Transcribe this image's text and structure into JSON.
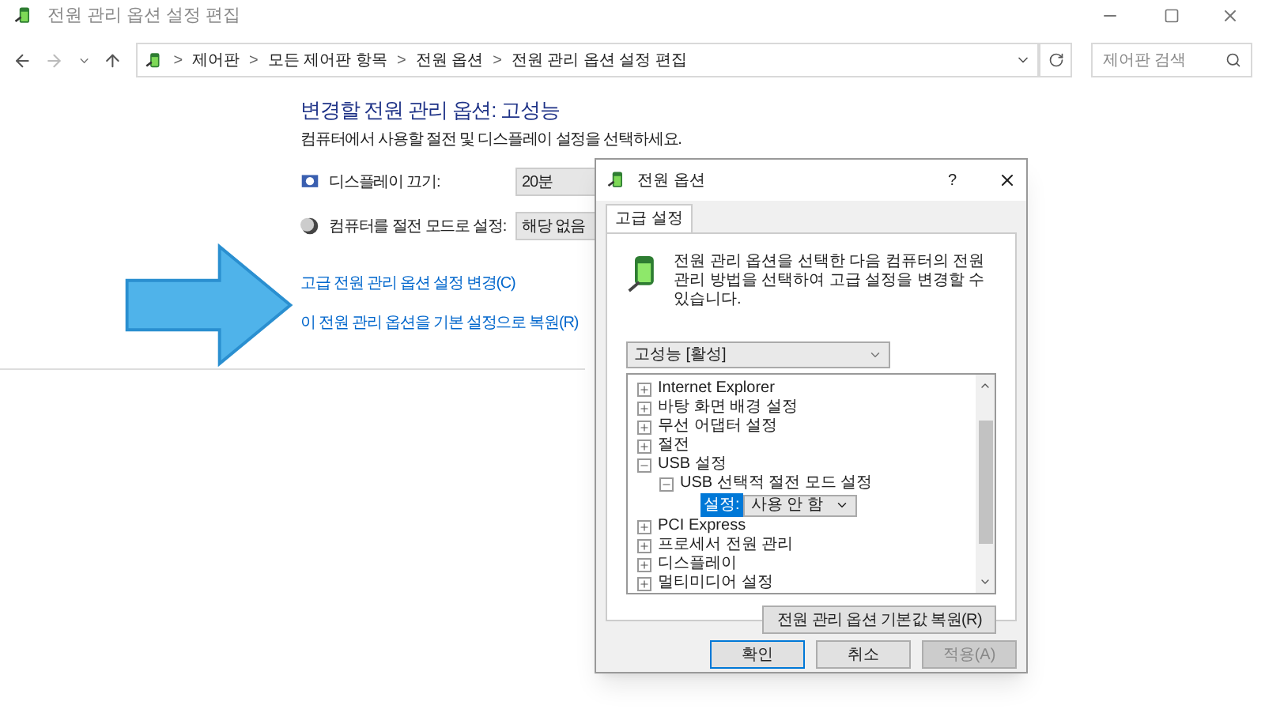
{
  "window": {
    "title": "전원 관리 옵션 설정 편집"
  },
  "address": {
    "crumbs": [
      "제어판",
      "모든 제어판 항목",
      "전원 옵션",
      "전원 관리 옵션 설정 편집"
    ],
    "separator": ">"
  },
  "search": {
    "placeholder": "제어판 검색"
  },
  "content": {
    "heading": "변경할 전원 관리 옵션: 고성능",
    "description": "컴퓨터에서 사용할 절전 및 디스플레이 설정을 선택하세요.",
    "settings": [
      {
        "label": "디스플레이 끄기:",
        "value": "20분",
        "kind": "display"
      },
      {
        "label": "컴퓨터를 절전 모드로 설정:",
        "value": "해당 없음",
        "kind": "sleep"
      }
    ],
    "links": [
      "고급 전원 관리 옵션 설정 변경(C)",
      "이 전원 관리 옵션을 기본 설정으로 복원(R)"
    ]
  },
  "dialog": {
    "title": "전원 옵션",
    "help": "?",
    "tabs": [
      {
        "label": "고급 설정",
        "selected": true
      }
    ],
    "intro": "전원 관리 옵션을 선택한 다음 컴퓨터의 전원 관리 방법을 선택하여 고급 설정을 변경할 수 있습니다.",
    "plan": "고성능 [활성]",
    "tree": [
      {
        "label": "Internet Explorer",
        "expanded": false
      },
      {
        "label": "바탕 화면 배경 설정",
        "expanded": false
      },
      {
        "label": "무선 어댑터 설정",
        "expanded": false
      },
      {
        "label": "절전",
        "expanded": false
      },
      {
        "label": "USB 설정",
        "expanded": true,
        "children": [
          {
            "label": "USB 선택적 절전 모드 설정",
            "expanded": true,
            "setting": {
              "label": "설정:",
              "value": "사용 안 함",
              "selected": true
            }
          }
        ]
      },
      {
        "label": "PCI Express",
        "expanded": false
      },
      {
        "label": "프로세서 전원 관리",
        "expanded": false
      },
      {
        "label": "디스플레이",
        "expanded": false
      },
      {
        "label": "멀티미디어 설정",
        "expanded": false
      }
    ],
    "restore": "전원 관리 옵션 기본값 복원(R)",
    "buttons": [
      {
        "label": "확인",
        "disabled": false,
        "default": true
      },
      {
        "label": "취소",
        "disabled": false,
        "default": false
      },
      {
        "label": "적용(A)",
        "disabled": true,
        "default": false
      }
    ]
  }
}
